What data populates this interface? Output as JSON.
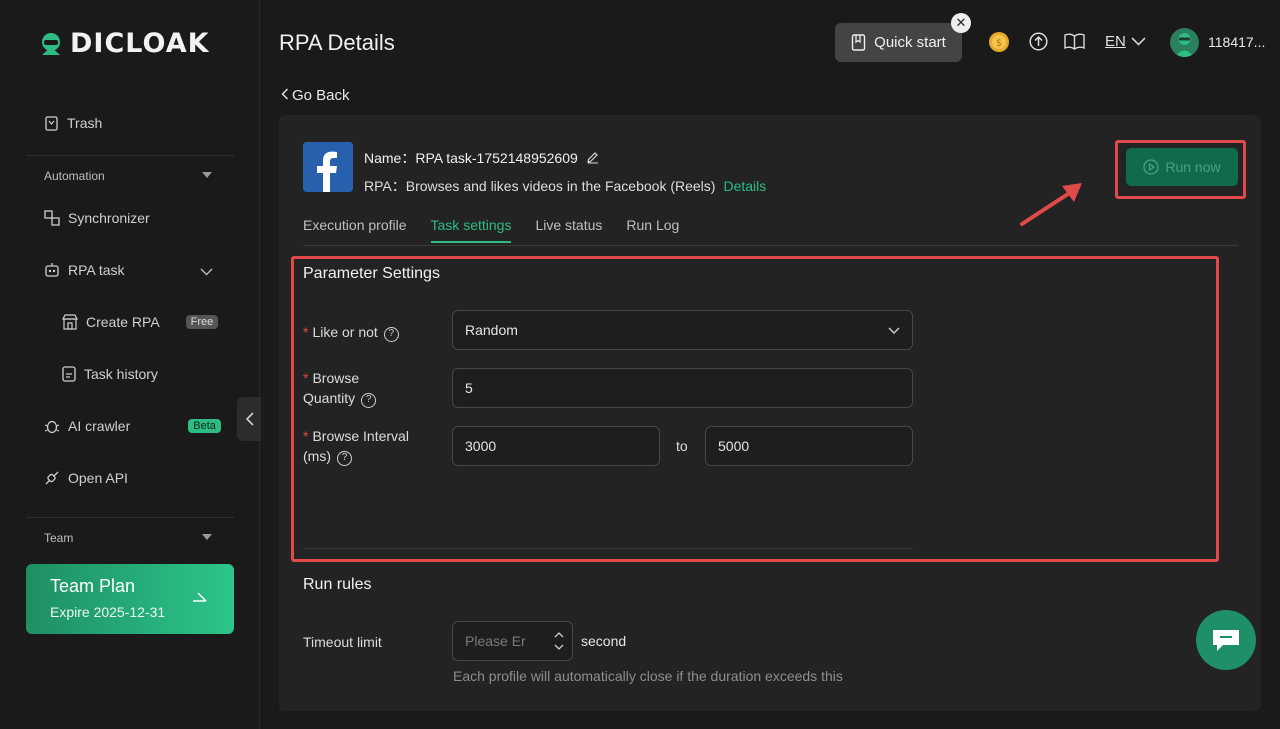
{
  "app": {
    "logo_text": "DICLOAK",
    "page_title": "RPA Details"
  },
  "sidebar": {
    "trash": "Trash",
    "automation_label": "Automation",
    "synchronizer": "Synchronizer",
    "rpa_task": "RPA task",
    "create_rpa": "Create RPA",
    "free_badge": "Free",
    "task_history": "Task history",
    "ai_crawler": "AI crawler",
    "beta_badge": "Beta",
    "open_api": "Open API",
    "team_label": "Team",
    "team_card": {
      "title": "Team Plan",
      "expire": "Expire 2025-12-31"
    }
  },
  "header": {
    "quick_start": "Quick start",
    "language": "EN",
    "user_id": "118417..."
  },
  "main": {
    "go_back": "Go Back",
    "task": {
      "name_label": "Name：",
      "name_value": "RPA task-1752148952609",
      "rpa_label": "RPA：",
      "rpa_value": "Browses and likes videos in the Facebook (Reels)",
      "details_link": "Details"
    },
    "run_now": "Run now",
    "tabs": [
      "Execution profile",
      "Task settings",
      "Live status",
      "Run Log"
    ],
    "active_tab": "Task settings",
    "parameter_settings": {
      "title": "Parameter Settings",
      "like_label": "Like or not",
      "like_value": "Random",
      "browse_qty_label_1": "Browse",
      "browse_qty_label_2": "Quantity",
      "browse_qty_value": "5",
      "interval_label_1": "Browse Interval",
      "interval_label_2": "(ms)",
      "interval_from": "3000",
      "interval_to_label": "to",
      "interval_to": "5000"
    },
    "run_rules": {
      "title": "Run rules",
      "timeout_label": "Timeout limit",
      "timeout_placeholder": "Please Er",
      "timeout_suffix": "second",
      "timeout_hint": "Each profile will automatically close if the duration exceeds this"
    }
  },
  "colors": {
    "accent": "#2dbd84",
    "highlight_box": "#e14a4a",
    "background": "#1a1a1a",
    "panel": "#232323"
  },
  "icons": [
    "logo-icon",
    "trash-icon",
    "synchronizer-icon",
    "robot-icon",
    "store-icon",
    "document-icon",
    "bug-icon",
    "api-icon",
    "arrow-right-icon",
    "chevron-left-icon",
    "book-icon",
    "close-icon",
    "coin-icon",
    "upload-icon",
    "guide-icon",
    "chevron-down-icon",
    "avatar",
    "facebook-icon",
    "edit-icon",
    "play-icon",
    "red-arrow",
    "help-icon",
    "chat-icon"
  ]
}
